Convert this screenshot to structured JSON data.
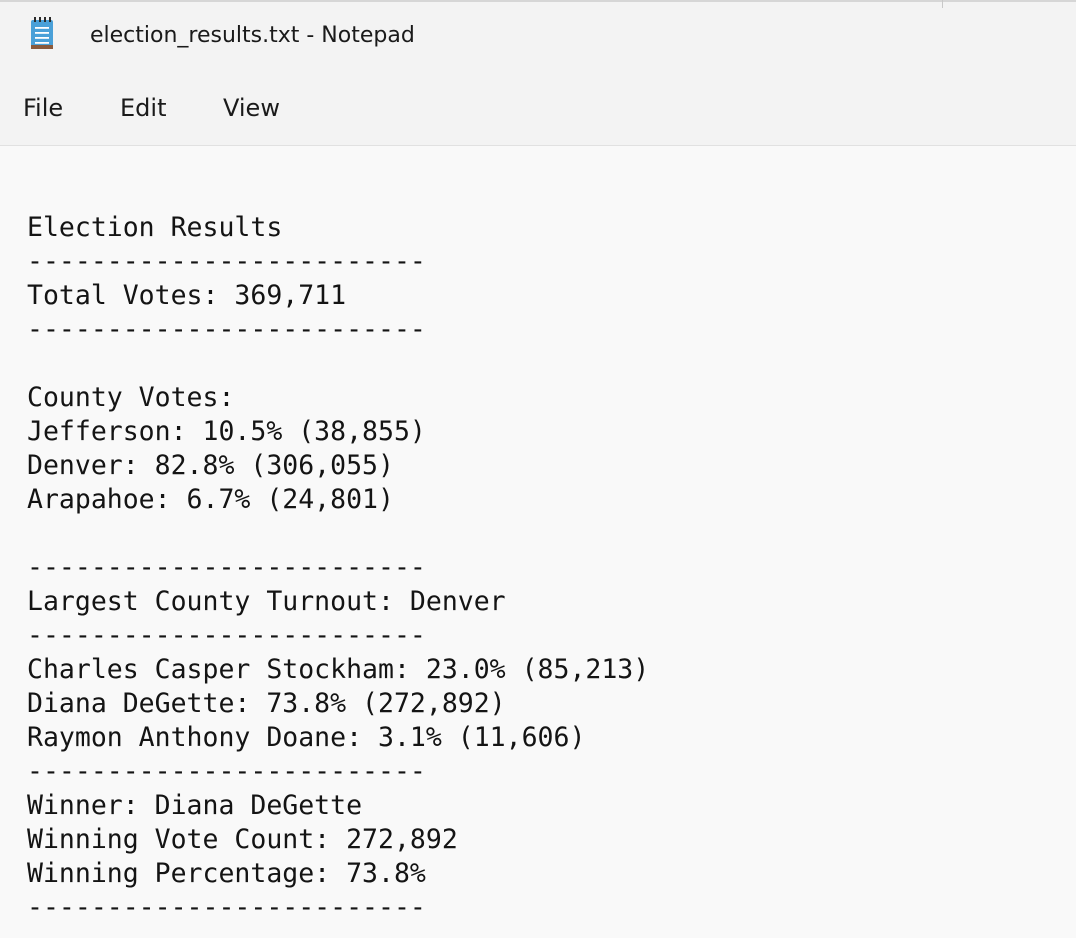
{
  "window": {
    "title": "election_results.txt - Notepad",
    "app_icon": "notepad-icon"
  },
  "menu": {
    "file": "File",
    "edit": "Edit",
    "view": "View"
  },
  "document": {
    "lines": [
      "Election Results",
      "-------------------------",
      "Total Votes: 369,711",
      "-------------------------",
      "",
      "County Votes:",
      "Jefferson: 10.5% (38,855)",
      "Denver: 82.8% (306,055)",
      "Arapahoe: 6.7% (24,801)",
      "",
      "-------------------------",
      "Largest County Turnout: Denver",
      "-------------------------",
      "Charles Casper Stockham: 23.0% (85,213)",
      "Diana DeGette: 73.8% (272,892)",
      "Raymon Anthony Doane: 3.1% (11,606)",
      "-------------------------",
      "Winner: Diana DeGette",
      "Winning Vote Count: 272,892",
      "Winning Percentage: 73.8%",
      "-------------------------"
    ]
  }
}
